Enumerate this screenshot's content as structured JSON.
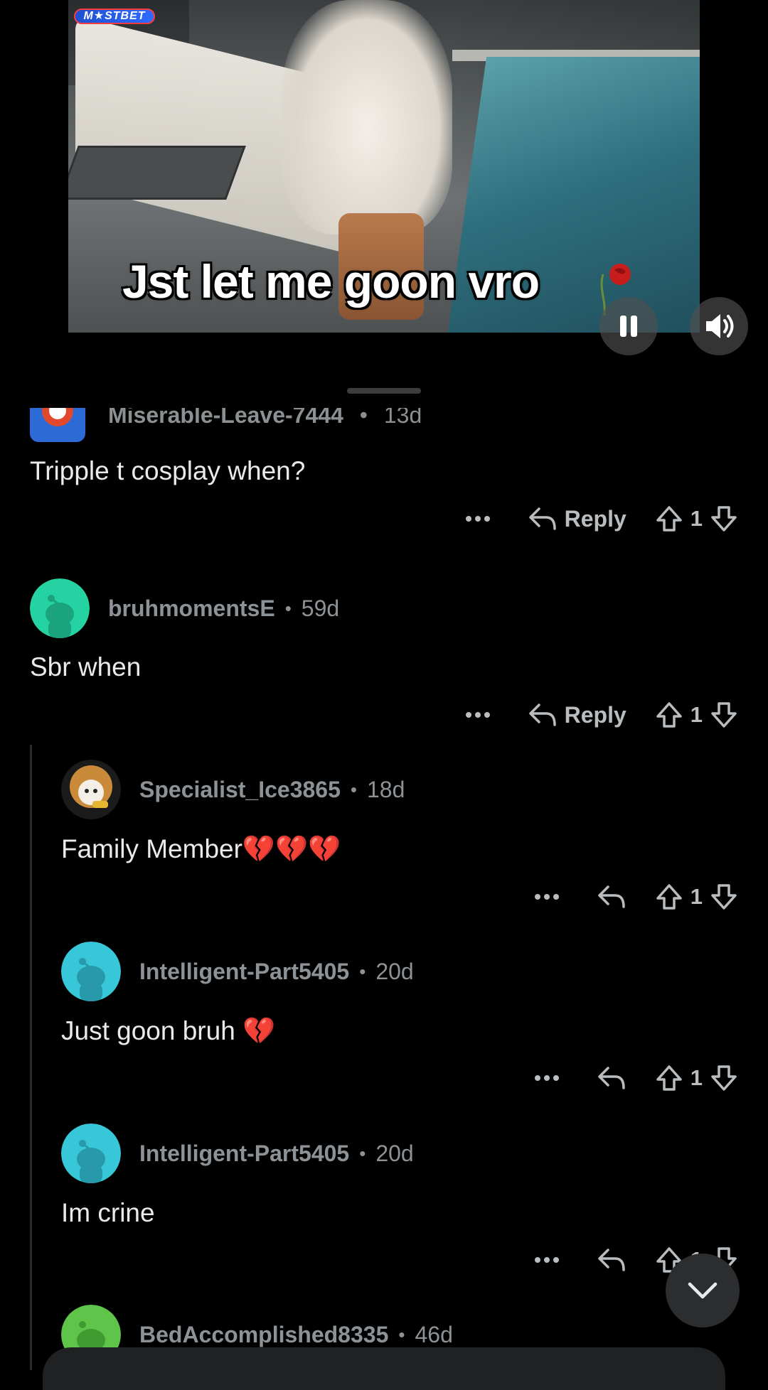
{
  "video": {
    "brand_badge": "M★STBET",
    "caption": "Jst let me goon vro"
  },
  "partial_comment": {
    "username": "Miserable-Leave-7444",
    "age": "13d",
    "body": "Tripple t cosplay when?",
    "reply_label": "Reply",
    "score": "1"
  },
  "comments": [
    {
      "username": "bruhmomentsE",
      "age": "59d",
      "body": "Sbr when",
      "reply_label": "Reply",
      "score": "1",
      "avatar_color": "#24d3a1"
    },
    {
      "username": "Specialist_Ice3865",
      "age": "18d",
      "body": "Family Member💔💔💔",
      "score": "1"
    },
    {
      "username": "Intelligent-Part5405",
      "age": "20d",
      "body": "Just goon bruh 💔",
      "score": "1",
      "avatar_color": "#38c7d9"
    },
    {
      "username": "Intelligent-Part5405",
      "age": "20d",
      "body": "Im crine",
      "score": "1",
      "avatar_color": "#38c7d9"
    },
    {
      "username": "BedAccomplished8335",
      "age": "46d",
      "avatar_color": "#5fc44a"
    }
  ],
  "separator": "•",
  "icons": {
    "more": "more-icon",
    "reply": "reply-icon",
    "upvote": "upvote-icon",
    "downvote": "downvote-icon",
    "scroll_down": "chevron-down-icon",
    "pause": "pause-icon",
    "sound": "sound-icon"
  }
}
